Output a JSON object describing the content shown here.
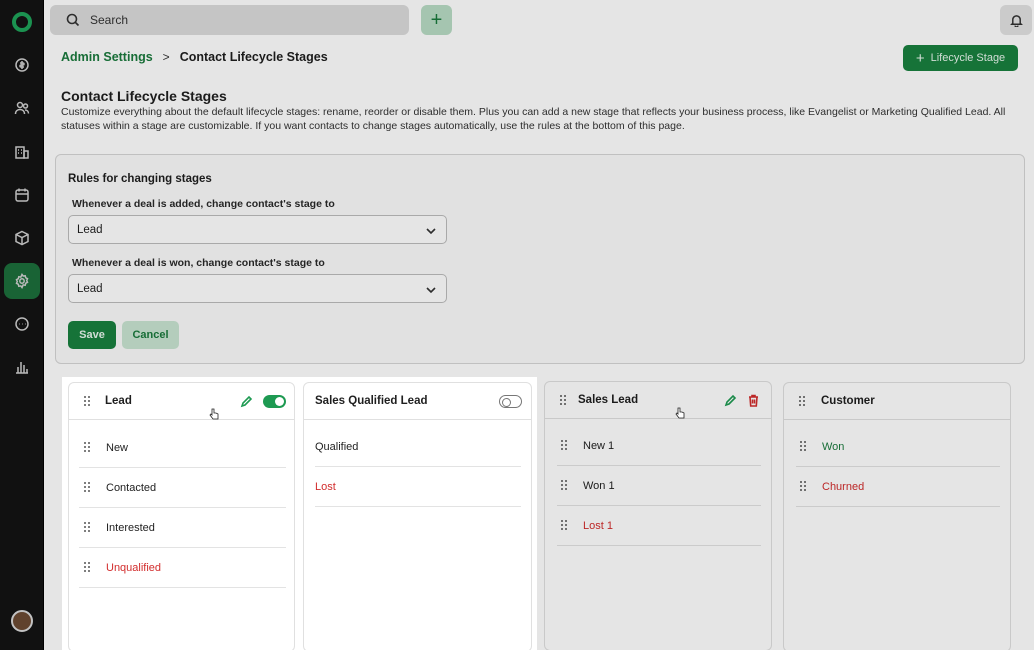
{
  "sidebar": {
    "items": [
      "money-icon",
      "contacts-icon",
      "company-icon",
      "calendar-icon",
      "product-icon",
      "settings-icon",
      "chat-icon",
      "reports-icon"
    ],
    "active": "settings-icon"
  },
  "topbar": {
    "search_placeholder": "Search"
  },
  "breadcrumb": {
    "parent": "Admin Settings",
    "separator": ">",
    "current": "Contact Lifecycle Stages"
  },
  "add_stage_label": "Lifecycle Stage",
  "page": {
    "title": "Contact Lifecycle Stages",
    "description": "Customize everything about the default lifecycle stages: rename, reorder or disable them. Plus you can add a new stage that reflects your business process, like Evangelist or Marketing Qualified Lead. All statuses within a stage are customizable. If you want contacts to change stages automatically, use the rules at the bottom of this page."
  },
  "rules": {
    "title": "Rules for changing stages",
    "deal_added_label": "Whenever a deal is added, change contact's stage to",
    "deal_added_value": "Lead",
    "deal_won_label": "Whenever a deal is won, change contact's stage to",
    "deal_won_value": "Lead",
    "save_label": "Save",
    "cancel_label": "Cancel"
  },
  "stages": [
    {
      "title": "Lead",
      "enabled": true,
      "statuses": [
        {
          "label": "New",
          "color": "default"
        },
        {
          "label": "Contacted",
          "color": "default"
        },
        {
          "label": "Interested",
          "color": "default"
        },
        {
          "label": "Unqualified",
          "color": "red"
        }
      ]
    },
    {
      "title": "Sales Qualified Lead",
      "enabled": false,
      "statuses": [
        {
          "label": "Qualified",
          "color": "default"
        },
        {
          "label": "Lost",
          "color": "red"
        }
      ]
    },
    {
      "title": "Sales Lead",
      "statuses": [
        {
          "label": "New 1",
          "color": "default"
        },
        {
          "label": "Won 1",
          "color": "default"
        },
        {
          "label": "Lost 1",
          "color": "red"
        }
      ]
    },
    {
      "title": "Customer",
      "statuses": [
        {
          "label": "Won",
          "color": "green"
        },
        {
          "label": "Churned",
          "color": "red"
        }
      ]
    }
  ],
  "colors": {
    "brand_green": "#19803f",
    "danger_red": "#d22c2c",
    "sidebar_bg": "#141414"
  }
}
